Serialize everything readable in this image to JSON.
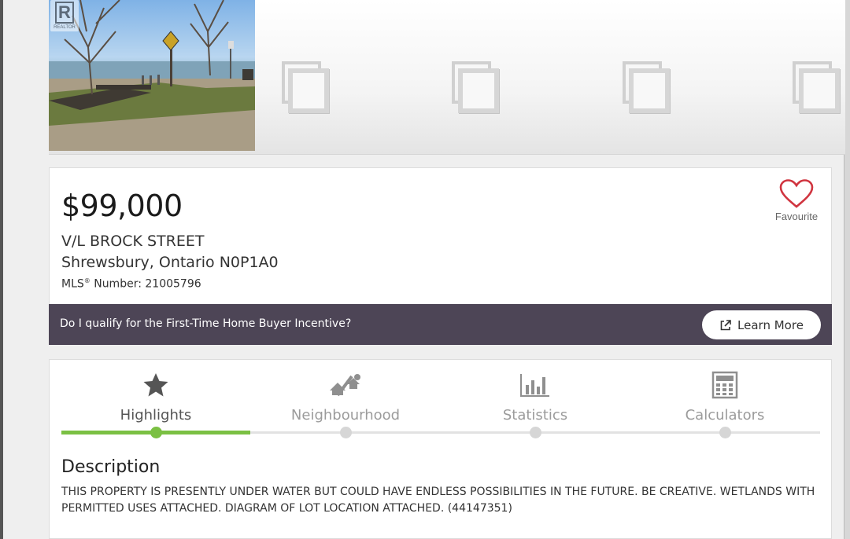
{
  "gallery": {
    "logo_text": "R",
    "logo_caption": "REALTOR",
    "thumbnail_icon": "photo-stack-icon"
  },
  "listing": {
    "price": "$99,000",
    "address_line1": "V/L BROCK STREET",
    "address_line2": "Shrewsbury, Ontario N0P1A0",
    "mls_label": "MLS",
    "mls_sup": "®",
    "mls_number_text": " Number: 21005796",
    "favourite_label": "Favourite"
  },
  "banner": {
    "question": "Do I qualify for the First-Time Home Buyer Incentive?",
    "button_label": "Learn More"
  },
  "tabs": [
    {
      "label": "Highlights",
      "icon": "star-icon",
      "active": true
    },
    {
      "label": "Neighbourhood",
      "icon": "neighbourhood-icon",
      "active": false
    },
    {
      "label": "Statistics",
      "icon": "bar-chart-icon",
      "active": false
    },
    {
      "label": "Calculators",
      "icon": "calculator-icon",
      "active": false
    }
  ],
  "description": {
    "title": "Description",
    "body": "THIS PROPERTY IS PRESENTLY UNDER WATER BUT COULD HAVE ENDLESS POSSIBILITIES IN THE FUTURE. BE CREATIVE. WETLANDS WITH PERMITTED USES ATTACHED. DIAGRAM OF LOT LOCATION ATTACHED. (44147351)"
  },
  "colors": {
    "accent_green": "#7bc043",
    "banner_purple": "#4d4556",
    "heart_red": "#d0343f"
  }
}
